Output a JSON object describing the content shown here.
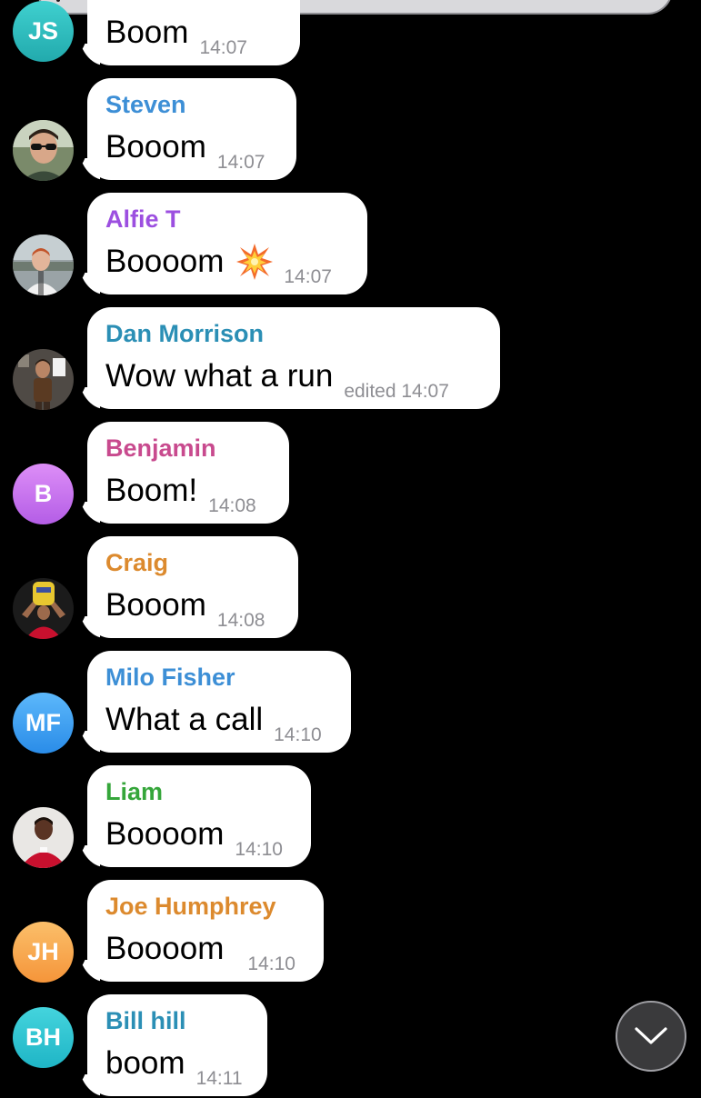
{
  "messages": [
    {
      "sender": "",
      "sender_color": "#2aa6a6",
      "text": "Boom",
      "time": "14:07",
      "avatar": {
        "type": "initials",
        "initials": "JS",
        "color": "#31c0c0"
      }
    },
    {
      "sender": "Steven",
      "sender_color": "#3d8fd6",
      "text": "Booom",
      "time": "14:07",
      "avatar": {
        "type": "photo",
        "name": "steven-photo"
      }
    },
    {
      "sender": "Alfie T",
      "sender_color": "#9c4fe0",
      "text": "Boooom",
      "time": "14:07",
      "emoji": "collision",
      "avatar": {
        "type": "photo",
        "name": "alfie-photo"
      }
    },
    {
      "sender": "Dan Morrison",
      "sender_color": "#2b8fb5",
      "text": "Wow what a run",
      "time": "edited 14:07",
      "avatar": {
        "type": "photo",
        "name": "dan-photo"
      }
    },
    {
      "sender": "Benjamin",
      "sender_color": "#c84a8e",
      "text": "Boom!",
      "time": "14:08",
      "avatar": {
        "type": "initials",
        "initials": "B",
        "color": "#c771ec"
      }
    },
    {
      "sender": "Craig",
      "sender_color": "#dc8a2e",
      "text": "Booom",
      "time": "14:08",
      "avatar": {
        "type": "photo",
        "name": "craig-photo"
      }
    },
    {
      "sender": "Milo Fisher",
      "sender_color": "#3d8fd6",
      "text": "What a call",
      "time": "14:10",
      "avatar": {
        "type": "initials",
        "initials": "MF",
        "color": "#3ea1f4"
      }
    },
    {
      "sender": "Liam",
      "sender_color": "#35a63a",
      "text": "Boooom",
      "time": "14:10",
      "avatar": {
        "type": "photo",
        "name": "liam-photo"
      }
    },
    {
      "sender": "Joe Humphrey",
      "sender_color": "#dc8a2e",
      "text": "Boooom",
      "time": "14:10",
      "avatar": {
        "type": "initials",
        "initials": "JH",
        "color": "#f7a84f"
      }
    },
    {
      "sender": "Bill hill",
      "sender_color": "#2b8fb5",
      "text": "boom",
      "time": "14:11",
      "avatar": {
        "type": "initials",
        "initials": "BH",
        "color": "#2fc4d4"
      }
    }
  ],
  "scroll_button": {
    "icon": "chevron-down-icon"
  },
  "top_banner": {
    "accent": "#f5c400"
  }
}
